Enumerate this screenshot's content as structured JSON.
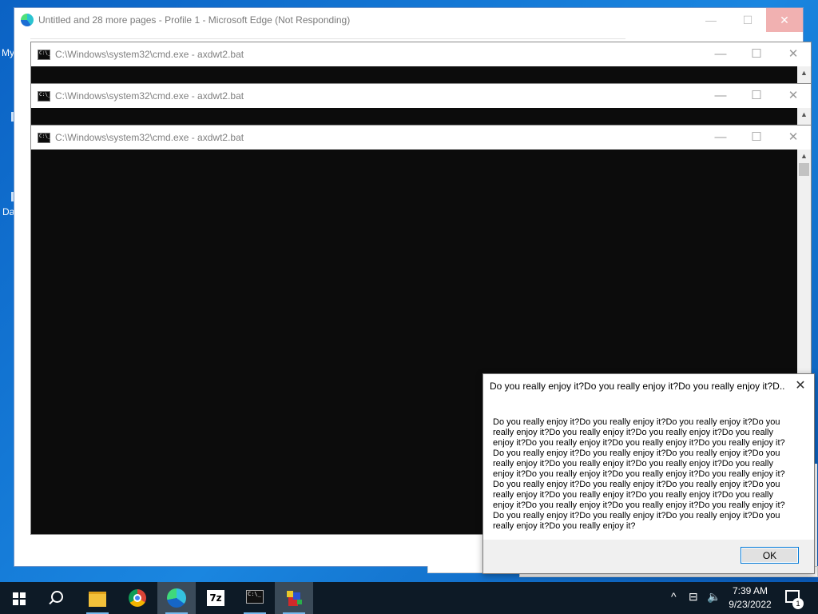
{
  "desktop": {
    "label_my": "My",
    "label_da": "Da"
  },
  "edge": {
    "title": "Untitled and 28 more pages - Profile 1 - Microsoft Edge (Not Responding)",
    "minimize": "—",
    "maximize": "☐",
    "close": "✕"
  },
  "cmd_windows": [
    {
      "title": "C:\\Windows\\system32\\cmd.exe - axdwt2.bat"
    },
    {
      "title": "C:\\Windows\\system32\\cmd.exe - axdwt2.bat"
    },
    {
      "title": "C:\\Windows\\system32\\cmd.exe - axdwt2.bat"
    }
  ],
  "cmd_controls": {
    "minimize": "—",
    "maximize": "☐",
    "close": "✕",
    "icon_text": "C:\\_"
  },
  "message_box": {
    "title": "Do you really enjoy it?Do you really enjoy it?Do you really enjoy it?D...",
    "body": "Do you really enjoy it?Do you really enjoy it?Do you really enjoy it?Do you really enjoy it?Do you really enjoy it?Do you really enjoy it?Do you really enjoy it?Do you really enjoy it?Do you really enjoy it?Do you really enjoy it?Do you really enjoy it?Do you really enjoy it?Do you really enjoy it?Do you really enjoy it?Do you really enjoy it?Do you really enjoy it?Do you really enjoy it?Do you really enjoy it?Do you really enjoy it?Do you really enjoy it?Do you really enjoy it?Do you really enjoy it?Do you really enjoy it?Do you really enjoy it?Do you really enjoy it?Do you really enjoy it?Do you really enjoy it?Do you really enjoy it?Do you really enjoy it?Do you really enjoy it?Do you really enjoy it?Do you really enjoy it?Do you really enjoy it?Do you really enjoy it?Do you really enjoy it?",
    "ok_label": "OK",
    "close": "✕"
  },
  "taskbar": {
    "search_glyph": "",
    "zip_label": "7z",
    "terminal_label": "C:\\_",
    "tray": {
      "chevron": "^",
      "network": "⊟",
      "volume": "🔈"
    },
    "clock_time": "7:39 AM",
    "clock_date": "9/23/2022",
    "notification_count": "1"
  }
}
